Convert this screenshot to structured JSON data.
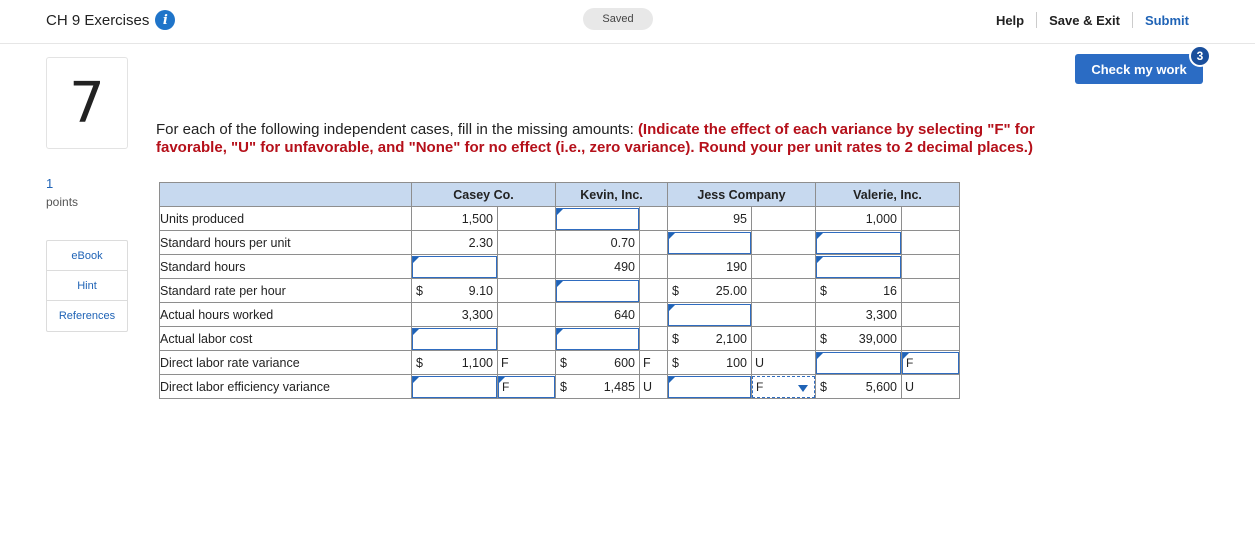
{
  "header": {
    "title": "CH 9 Exercises",
    "info_icon": "i",
    "saved": "Saved",
    "help": "Help",
    "save_exit": "Save & Exit",
    "submit": "Submit"
  },
  "check": {
    "label": "Check my work",
    "badge": "3"
  },
  "question": {
    "number": "7",
    "points_value": "1",
    "points_label": "points"
  },
  "side_links": [
    "eBook",
    "Hint",
    "References"
  ],
  "instructions": {
    "plain": "For each of the following independent cases, fill in the missing amounts: ",
    "bold": "(Indicate the effect of each variance by selecting \"F\" for favorable, \"U\" for unfavorable, and \"None\" for no effect (i.e., zero variance). Round your per unit rates to 2 decimal places.)"
  },
  "table": {
    "columns": [
      "Casey Co.",
      "Kevin, Inc.",
      "Jess Company",
      "Valerie, Inc."
    ],
    "rows": [
      {
        "label": "Units produced",
        "casey": {
          "value": "1,500"
        },
        "kevin": {
          "input": true
        },
        "jess": {
          "value": "95"
        },
        "valerie": {
          "value": "1,000"
        }
      },
      {
        "label": "Standard hours per unit",
        "casey": {
          "value": "2.30"
        },
        "kevin": {
          "value": "0.70"
        },
        "jess": {
          "input": true
        },
        "valerie": {
          "input": true
        }
      },
      {
        "label": "Standard hours",
        "casey": {
          "input": true
        },
        "kevin": {
          "value": "490"
        },
        "jess": {
          "value": "190"
        },
        "valerie": {
          "input": true
        }
      },
      {
        "label": "Standard rate per hour",
        "casey": {
          "dollar": "$",
          "value": "9.10"
        },
        "kevin": {
          "input": true
        },
        "jess": {
          "dollar": "$",
          "value": "25.00"
        },
        "valerie": {
          "dollar": "$",
          "value": "16"
        }
      },
      {
        "label": "Actual hours worked",
        "casey": {
          "value": "3,300"
        },
        "kevin": {
          "value": "640"
        },
        "jess": {
          "input": true
        },
        "valerie": {
          "value": "3,300"
        }
      },
      {
        "label": "Actual labor cost",
        "casey": {
          "input": true
        },
        "kevin": {
          "input": true
        },
        "jess": {
          "dollar": "$",
          "value": "2,100"
        },
        "valerie": {
          "dollar": "$",
          "value": "39,000"
        }
      },
      {
        "label": "Direct labor rate variance",
        "casey": {
          "dollar": "$",
          "value": "1,100",
          "effect": "F"
        },
        "kevin": {
          "dollar": "$",
          "value": "600",
          "effect": "F"
        },
        "jess": {
          "dollar": "$",
          "value": "100",
          "effect": "U"
        },
        "valerie": {
          "input": true,
          "effect_select": "F"
        }
      },
      {
        "label": "Direct labor efficiency variance",
        "casey": {
          "input": true,
          "effect_select": "F"
        },
        "kevin": {
          "dollar": "$",
          "value": "1,485",
          "effect": "U"
        },
        "jess": {
          "input": true,
          "effect_select": "F"
        },
        "valerie": {
          "dollar": "$",
          "value": "5,600",
          "effect": "U"
        }
      }
    ]
  }
}
